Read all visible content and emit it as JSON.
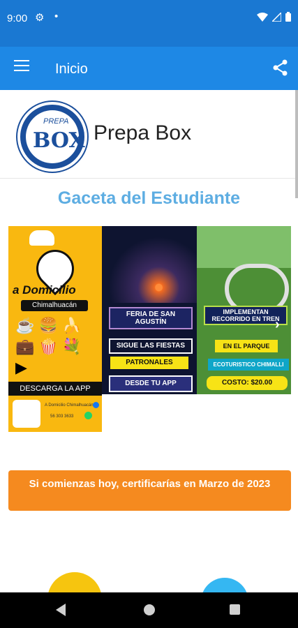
{
  "status_bar": {
    "time": "9:00",
    "gear_icon": "⚙",
    "dot": "•"
  },
  "app_bar": {
    "title": "Inicio"
  },
  "brand": {
    "logo_top": "PREPA",
    "logo_word": "BOX",
    "name": "Prepa Box"
  },
  "section_title": "Gaceta del Estudiante",
  "carousel": {
    "panel_a": {
      "title": "a Domicilio",
      "subtitle": "Chimalhuacán",
      "download": "DESCARGA LA APP",
      "fb": "A Domicilio Chimalhuacán",
      "phone": "56 303 3633"
    },
    "panel_b": {
      "title": "FERIA DE SAN AGUSTÍN",
      "line1": "SIGUE LAS FIESTAS",
      "line2": "PATRONALES",
      "line3": "DESDE TU APP"
    },
    "panel_c": {
      "title": "IMPLEMENTAN RECORRIDO EN TREN",
      "line1": "EN EL PARQUE",
      "line2": "ECOTURISTICO CHIMALLI",
      "line3": "COSTO: $20.00"
    },
    "next_icon": "›"
  },
  "cta": {
    "label": "Si comienzas hoy, certificarías en Marzo de 2023"
  },
  "colors": {
    "status_bar": "#1a78d2",
    "app_bar": "#1e88e5",
    "section_title": "#5dade2",
    "cta": "#f58a1f"
  }
}
